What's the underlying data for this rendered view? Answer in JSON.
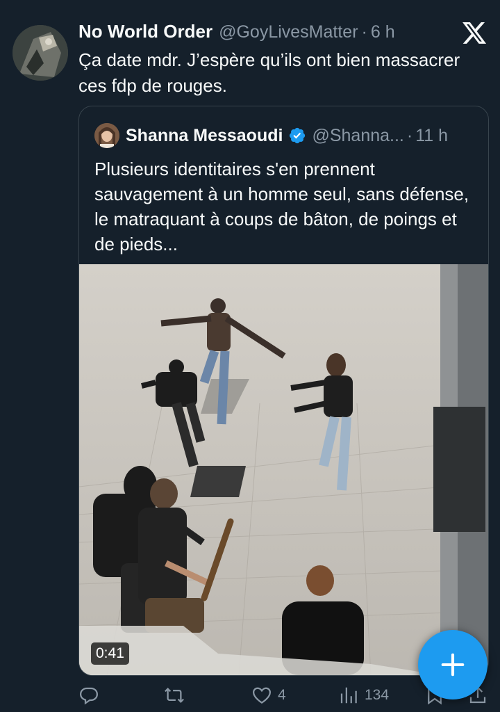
{
  "tweet": {
    "author_name": "No World Order",
    "author_handle": "@GoyLivesMatter",
    "separator": "·",
    "time": "6 h",
    "text": "Ça date mdr. J’espère qu’ils ont bien massacrer ces fdp de rouges.",
    "platform_icon": "x-logo-icon"
  },
  "quoted_tweet": {
    "author_name": "Shanna Messaoudi",
    "verified": true,
    "author_handle": "@Shanna...",
    "separator": "·",
    "time": "11 h",
    "text": "Plusieurs identitaires s'en prennent sauvagement à un homme seul, sans défense, le matraquant à coups de bâton, de poings et de pieds...",
    "video": {
      "duration": "0:41"
    }
  },
  "actions": {
    "reply": {
      "icon": "reply-icon",
      "count": ""
    },
    "repost": {
      "icon": "repost-icon",
      "count": ""
    },
    "like": {
      "icon": "heart-icon",
      "count": "4"
    },
    "views": {
      "icon": "views-icon",
      "count": "134"
    },
    "bookmark": {
      "icon": "bookmark-icon",
      "count": ""
    },
    "share": {
      "icon": "share-icon",
      "count": ""
    }
  },
  "compose_button": {
    "icon": "plus-icon"
  },
  "colors": {
    "background": "#15202b",
    "text_primary": "#f7f9f9",
    "text_secondary": "#8b98a5",
    "accent": "#1d9bf0",
    "border": "#38444d"
  }
}
